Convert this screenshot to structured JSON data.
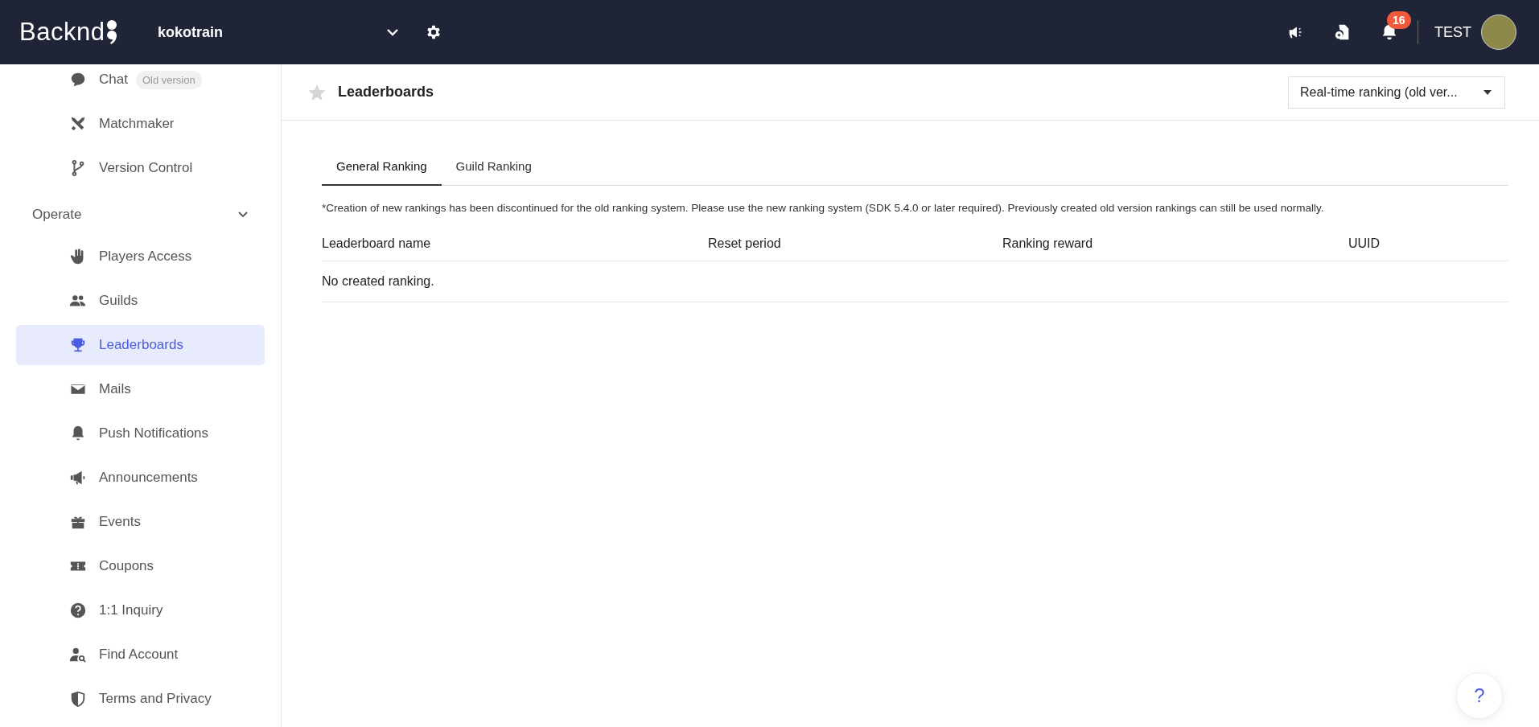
{
  "header": {
    "logo": "Backnd",
    "project": "kokotrain",
    "notification_count": "16",
    "user": "TEST"
  },
  "sidebar": {
    "items": [
      {
        "label": "Chat",
        "badge": "Old version",
        "selected": false
      },
      {
        "label": "Matchmaker",
        "selected": false
      },
      {
        "label": "Version Control",
        "selected": false
      }
    ],
    "sections": [
      {
        "label": "Operate",
        "expanded": true,
        "items": [
          {
            "label": "Players Access",
            "selected": false
          },
          {
            "label": "Guilds",
            "selected": false
          },
          {
            "label": "Leaderboards",
            "selected": true
          },
          {
            "label": "Mails",
            "selected": false
          },
          {
            "label": "Push Notifications",
            "selected": false
          },
          {
            "label": "Announcements",
            "selected": false
          },
          {
            "label": "Events",
            "selected": false
          },
          {
            "label": "Coupons",
            "selected": false
          },
          {
            "label": "1:1 Inquiry",
            "selected": false
          },
          {
            "label": "Find Account",
            "selected": false
          },
          {
            "label": "Terms and Privacy",
            "selected": false
          }
        ]
      }
    ]
  },
  "page": {
    "title": "Leaderboards",
    "favorite": false,
    "mode_select": "Real-time ranking (old ver..."
  },
  "tabs": [
    {
      "label": "General Ranking",
      "selected": true
    },
    {
      "label": "Guild Ranking",
      "selected": false
    }
  ],
  "notice": "*Creation of new rankings has been discontinued for the old ranking system. Please use the new ranking system (SDK 5.4.0 or later required). Previously created old version rankings can still be used normally.",
  "table": {
    "columns": [
      "Leaderboard name",
      "Reset period",
      "Ranking reward",
      "UUID"
    ],
    "empty_message": "No created ranking."
  },
  "help_button": "?"
}
